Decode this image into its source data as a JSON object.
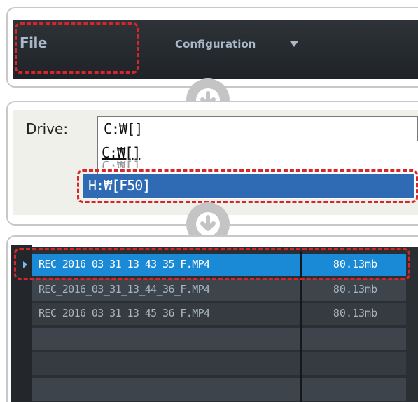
{
  "menu": {
    "file_label": "File",
    "config_label": "Configuration",
    "config_icon": "caret-down-icon"
  },
  "drive": {
    "label": "Drive:",
    "current_value": "C:₩[]",
    "options": [
      "C:₩[]",
      "H:₩[F50]"
    ],
    "selected_option": "H:₩[F50]",
    "selected_display": "H:₩[F50]"
  },
  "files": {
    "rows": [
      {
        "name": "REC_2016_03_31_13_43_35_F.MP4",
        "size": "80.13mb",
        "selected": true
      },
      {
        "name": "REC_2016_03_31_13_44_36_F.MP4",
        "size": "80.13mb",
        "selected": false
      },
      {
        "name": "REC_2016_03_31_13_45_36_F.MP4",
        "size": "80.13mb",
        "selected": false
      }
    ]
  },
  "colors": {
    "highlight_dashed": "#d6262b",
    "selection_blue": "#1b8ad6",
    "dropdown_selection": "#2f6ab5",
    "dark_bg": "#2a2f34"
  }
}
